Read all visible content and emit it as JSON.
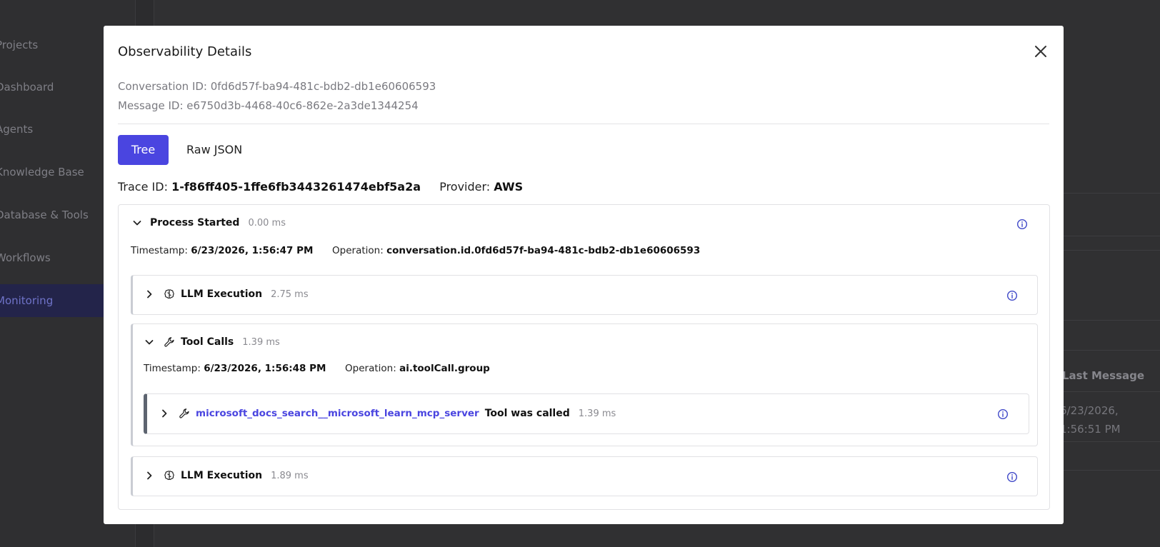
{
  "background": {
    "sidebar": [
      {
        "label": "Projects"
      },
      {
        "label": "Dashboard"
      },
      {
        "label": "Agents"
      },
      {
        "label": "Knowledge Base"
      },
      {
        "label": "Database & Tools"
      },
      {
        "label": "Workflows"
      },
      {
        "label": "Monitoring",
        "active": true
      }
    ],
    "table": {
      "last_message_header": "Last Message",
      "last_message_value_line1": "6/23/2026,",
      "last_message_value_line2": "1:56:51 PM"
    }
  },
  "modal": {
    "title": "Observability Details",
    "conversation_id_line": "Conversation ID: 0fd6d57f-ba94-481c-bdb2-db1e60606593",
    "message_id_line": "Message ID: e6750d3b-4468-40c6-862e-2a3de1344254",
    "tabs": {
      "tree": "Tree",
      "raw": "Raw JSON"
    },
    "trace_label": "Trace ID:",
    "trace_value": "1-f86ff405-1ffe6fb3443261474ebf5a2a",
    "provider_label": "Provider:",
    "provider_value": "AWS"
  },
  "tree": {
    "root": {
      "title": "Process Started",
      "duration": "0.00 ms",
      "timestamp_label": "Timestamp:",
      "timestamp": "6/23/2026, 1:56:47 PM",
      "operation_label": "Operation:",
      "operation": "conversation.id.0fd6d57f-ba94-481c-bdb2-db1e60606593"
    },
    "llm1": {
      "title": "LLM Execution",
      "duration": "2.75 ms"
    },
    "tools": {
      "title": "Tool Calls",
      "duration": "1.39 ms",
      "timestamp_label": "Timestamp:",
      "timestamp": "6/23/2026, 1:56:48 PM",
      "operation_label": "Operation:",
      "operation": "ai.toolCall.group",
      "call": {
        "name": "microsoft_docs_search__microsoft_learn_mcp_server",
        "status": "Tool was called",
        "duration": "1.39 ms"
      }
    },
    "llm2": {
      "title": "LLM Execution",
      "duration": "1.89 ms"
    }
  },
  "icons": {
    "close": "close-icon",
    "chevron_down": "chevron-down-icon",
    "chevron_right": "chevron-right-icon",
    "info": "info-icon",
    "brain": "brain-icon",
    "wrench": "wrench-icon"
  },
  "colors": {
    "accent": "#4a45e0",
    "info": "#3f48c8"
  }
}
